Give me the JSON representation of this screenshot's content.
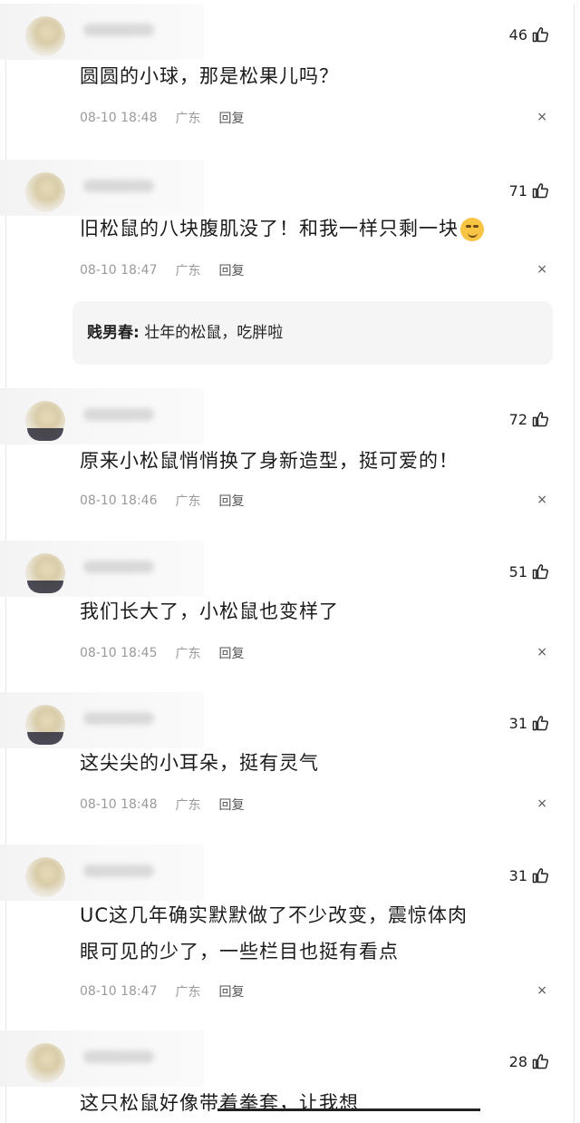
{
  "comments": [
    {
      "likes": "46",
      "text": "圆圆的小球，那是松果儿吗？",
      "time": "08-10 18:48",
      "location": "广东",
      "reply": "回复",
      "close": "×"
    },
    {
      "likes": "71",
      "text": "旧松鼠的八块腹肌没了！和我一样只剩一块",
      "time": "08-10 18:47",
      "location": "广东",
      "reply": "回复",
      "close": "×",
      "sub_reply": {
        "author": "贱男春:",
        "text": "壮年的松鼠，吃胖啦"
      }
    },
    {
      "likes": "72",
      "text": "原来小松鼠悄悄换了身新造型，挺可爱的！",
      "time": "08-10 18:46",
      "location": "广东",
      "reply": "回复",
      "close": "×"
    },
    {
      "likes": "51",
      "text": "我们长大了，小松鼠也变样了",
      "time": "08-10 18:45",
      "location": "广东",
      "reply": "回复",
      "close": "×"
    },
    {
      "likes": "31",
      "text": "这尖尖的小耳朵，挺有灵气",
      "time": "08-10 18:48",
      "location": "广东",
      "reply": "回复",
      "close": "×"
    },
    {
      "likes": "31",
      "text_line1": "UC这几年确实默默做了不少改变，震惊体肉",
      "text_line2": "眼可见的少了，一些栏目也挺有看点",
      "time": "08-10 18:47",
      "location": "广东",
      "reply": "回复",
      "close": "×"
    },
    {
      "likes": "28",
      "text": "这只松鼠好像带着拳套，让我想"
    }
  ],
  "icons": {
    "like": "thumbs-up-icon",
    "emoji": "smirk-emoji-icon",
    "close": "close-icon"
  }
}
